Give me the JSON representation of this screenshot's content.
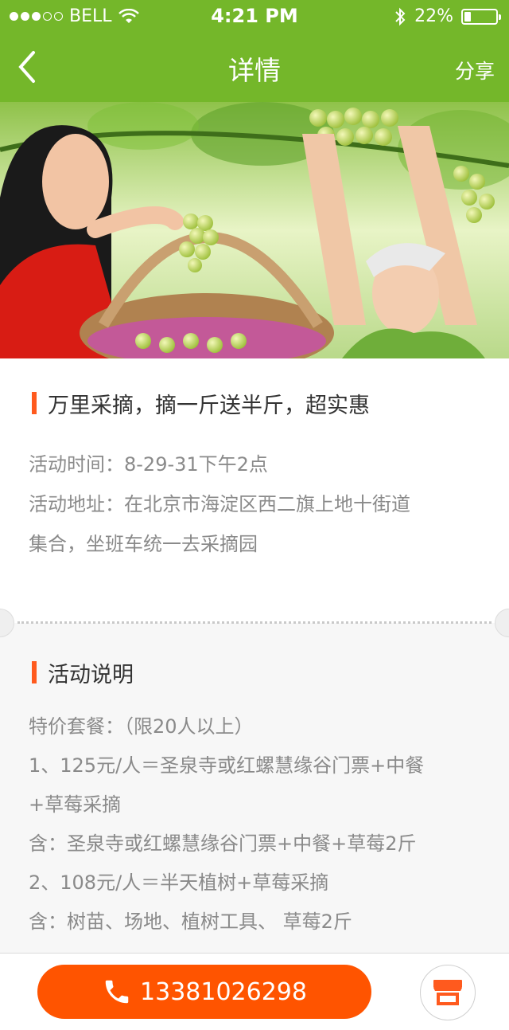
{
  "status": {
    "carrier": "BELL",
    "time": "4:21 PM",
    "battery": "22%",
    "battery_level": 0.22,
    "signal_bars_filled": 3,
    "signal_bars_total": 5
  },
  "nav": {
    "back_icon": "chevron-left-icon",
    "title": "详情",
    "share_label": "分享"
  },
  "banner": {
    "image": "grape-picking-photo"
  },
  "event": {
    "title": "万里采摘，摘一斤送半斤，超实惠",
    "info_lines": [
      "活动时间：8-29-31下午2点",
      "活动地址：在北京市海淀区西二旗上地十街道",
      "集合，坐班车统一去采摘园"
    ]
  },
  "description": {
    "heading": "活动说明",
    "lines": [
      "特价套餐：（限20人以上）",
      "1、125元/人＝圣泉寺或红螺慧缘谷门票+中餐",
      "+草莓采摘",
      "含：圣泉寺或红螺慧缘谷门票+中餐+草莓2斤",
      "2、108元/人＝半天植树+草莓采摘",
      "含：树苗、场地、植树工具、 草莓2斤"
    ]
  },
  "bottom_bar": {
    "phone": "13381026298",
    "phone_icon": "phone-icon",
    "store_icon": "store-icon"
  },
  "colors": {
    "header": "#74b72a",
    "accent": "#ff5400",
    "bar": "#ff5a1e",
    "text_gray": "#8a8a8a"
  }
}
